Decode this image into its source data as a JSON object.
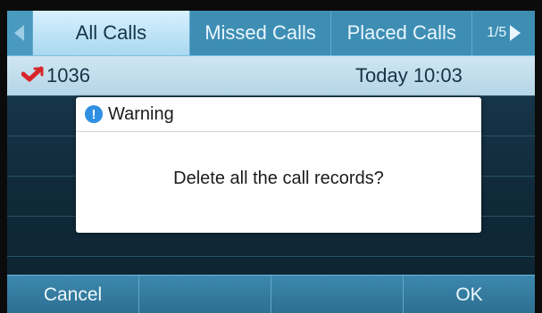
{
  "tabs": [
    {
      "label": "All Calls",
      "active": true
    },
    {
      "label": "Missed Calls",
      "active": false
    },
    {
      "label": "Placed Calls",
      "active": false
    }
  ],
  "page_indicator": "1/5",
  "calls": [
    {
      "number": "1036",
      "time": "Today 10:03",
      "type_icon": "missed-call-icon"
    }
  ],
  "dialog": {
    "title": "Warning",
    "message": "Delete all the call records?"
  },
  "softkeys": [
    "Cancel",
    "",
    "",
    "OK"
  ],
  "colors": {
    "accent": "#3e8eb4",
    "selected_row": "#cfe6f2",
    "missed_call": "#d7262b"
  }
}
